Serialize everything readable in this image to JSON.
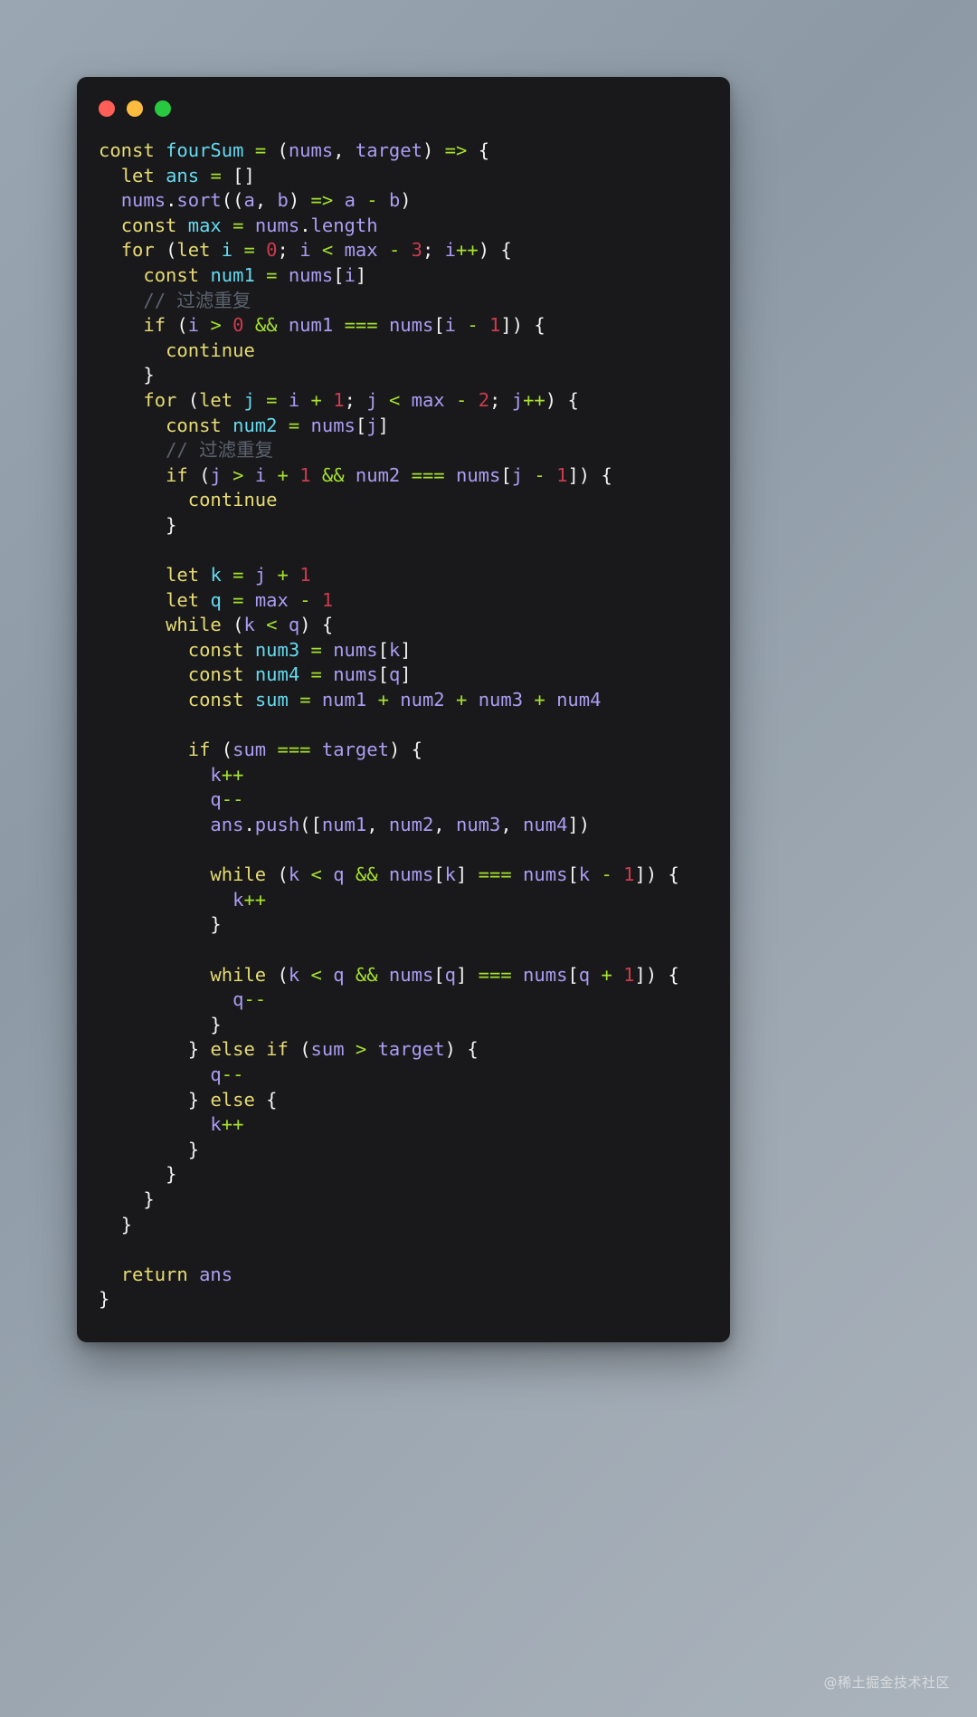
{
  "window": {
    "traffic_lights": [
      {
        "name": "close",
        "color": "#ff5f57"
      },
      {
        "name": "minimize",
        "color": "#fdbc40"
      },
      {
        "name": "maximize",
        "color": "#28c840"
      }
    ],
    "background_color": "#19191b"
  },
  "theme": {
    "keyword": "#e6db74",
    "function": "#66d9ef",
    "variable": "#ab9df2",
    "operator": "#a6e22e",
    "number": "#cc3b4e",
    "punctuation": "#f2f2f2",
    "comment": "#5c6370",
    "page_background": "#9aa7b2"
  },
  "watermark": {
    "text": "@稀土掘金技术社区"
  },
  "code": {
    "language": "javascript",
    "function_name": "fourSum",
    "line_count": 48,
    "text": "const fourSum = (nums, target) => {\n  let ans = []\n  nums.sort((a, b) => a - b)\n  const max = nums.length\n  for (let i = 0; i < max - 3; i++) {\n    const num1 = nums[i]\n    // 过滤重复\n    if (i > 0 && num1 === nums[i - 1]) {\n      continue\n    }\n    for (let j = i + 1; j < max - 2; j++) {\n      const num2 = nums[j]\n      // 过滤重复\n      if (j > i + 1 && num2 === nums[j - 1]) {\n        continue\n      }\n\n      let k = j + 1\n      let q = max - 1\n      while (k < q) {\n        const num3 = nums[k]\n        const num4 = nums[q]\n        const sum = num1 + num2 + num3 + num4\n\n        if (sum === target) {\n          k++\n          q--\n          ans.push([num1, num2, num3, num4])\n\n          while (k < q && nums[k] === nums[k - 1]) {\n            k++\n          }\n\n          while (k < q && nums[q] === nums[q + 1]) {\n            q--\n          }\n        } else if (sum > target) {\n          q--\n        } else {\n          k++\n        }\n      }\n    }\n  }\n\n  return ans\n}",
    "comments": [
      "// 过滤重复",
      "// 过滤重复"
    ],
    "lines": [
      "const fourSum = (nums, target) => {",
      "  let ans = []",
      "  nums.sort((a, b) => a - b)",
      "  const max = nums.length",
      "  for (let i = 0; i < max - 3; i++) {",
      "    const num1 = nums[i]",
      "    // 过滤重复",
      "    if (i > 0 && num1 === nums[i - 1]) {",
      "      continue",
      "    }",
      "    for (let j = i + 1; j < max - 2; j++) {",
      "      const num2 = nums[j]",
      "      // 过滤重复",
      "      if (j > i + 1 && num2 === nums[j - 1]) {",
      "        continue",
      "      }",
      "",
      "      let k = j + 1",
      "      let q = max - 1",
      "      while (k < q) {",
      "        const num3 = nums[k]",
      "        const num4 = nums[q]",
      "        const sum = num1 + num2 + num3 + num4",
      "",
      "        if (sum === target) {",
      "          k++",
      "          q--",
      "          ans.push([num1, num2, num3, num4])",
      "",
      "          while (k < q && nums[k] === nums[k - 1]) {",
      "            k++",
      "          }",
      "",
      "          while (k < q && nums[q] === nums[q + 1]) {",
      "            q--",
      "          }",
      "        } else if (sum > target) {",
      "          q--",
      "        } else {",
      "          k++",
      "        }",
      "      }",
      "    }",
      "  }",
      "",
      "  return ans",
      "}"
    ]
  }
}
